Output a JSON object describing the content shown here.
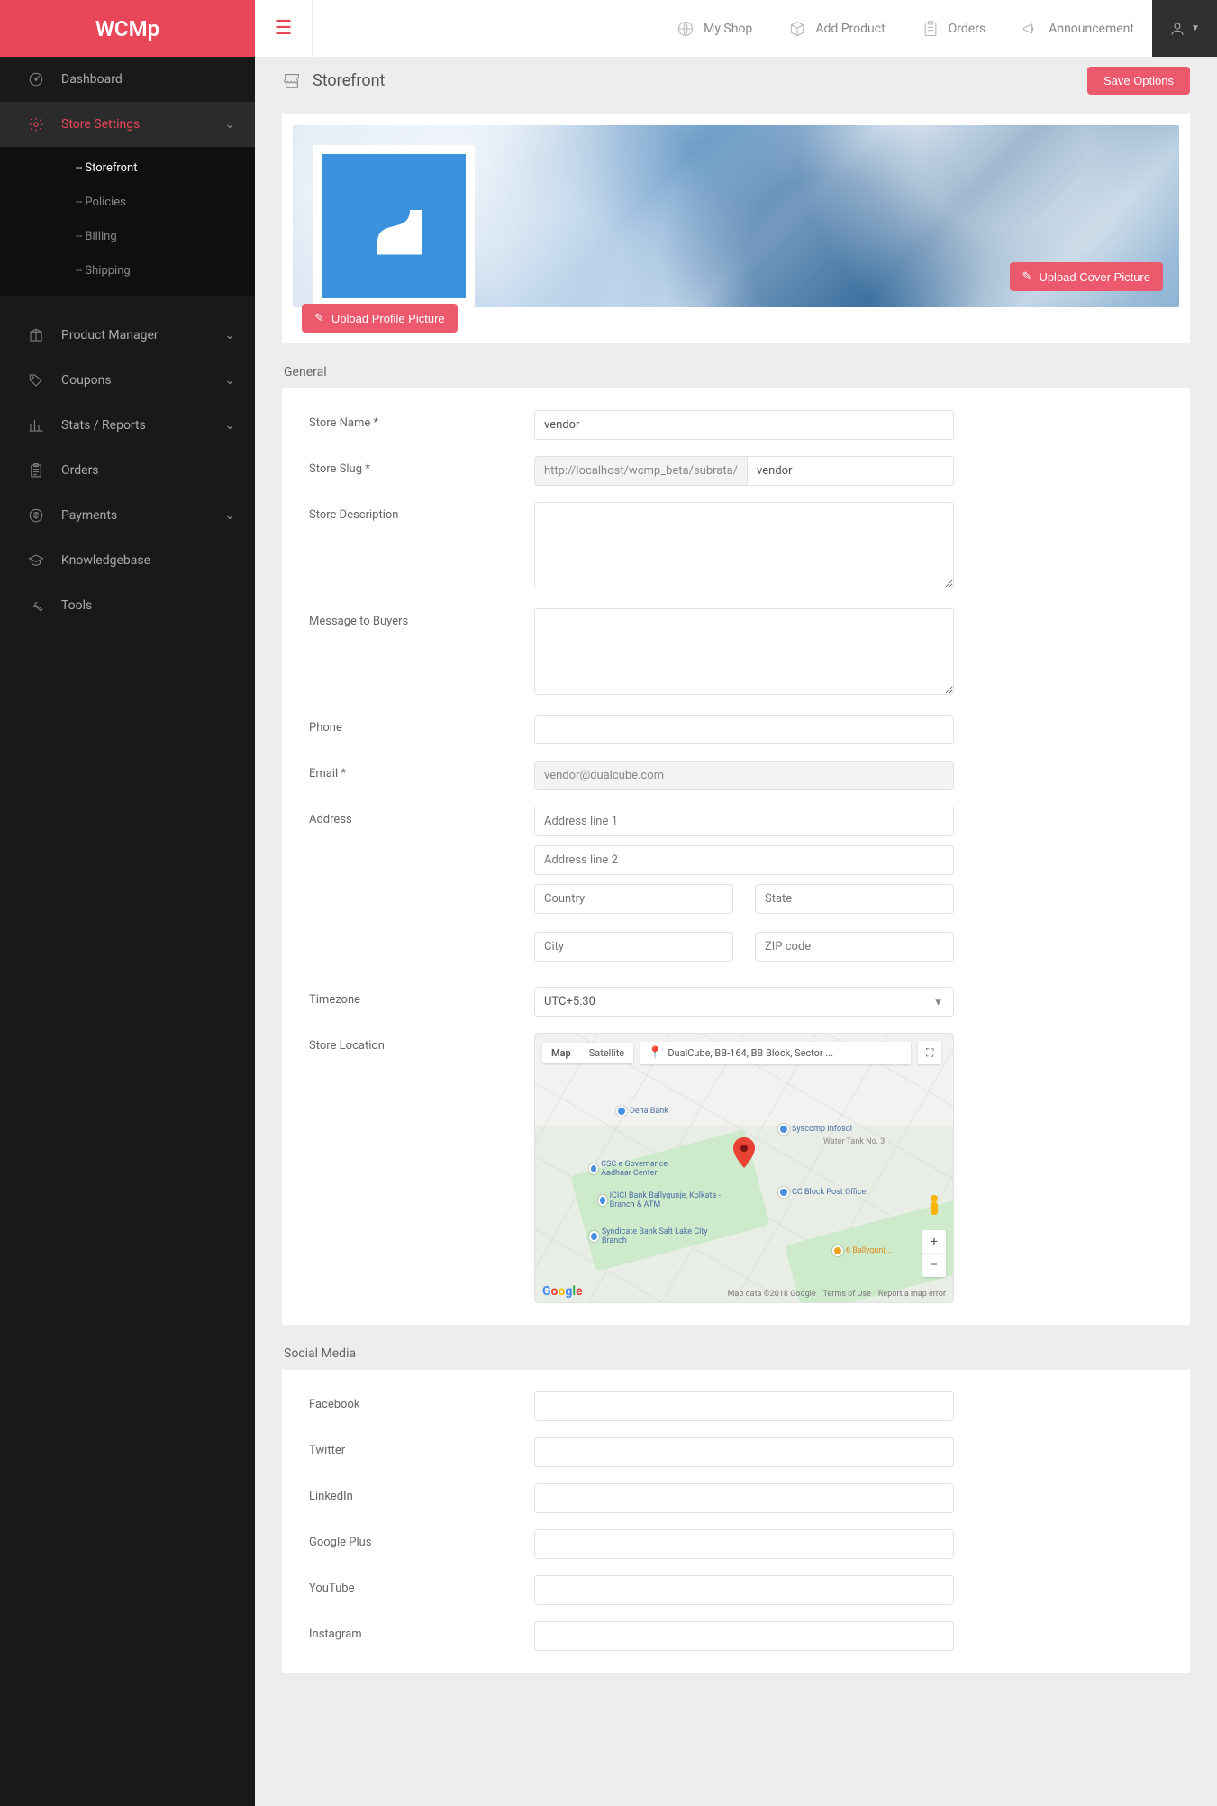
{
  "brand": "WCMp",
  "toplinks": {
    "my_shop": "My Shop",
    "add_product": "Add Product",
    "orders": "Orders",
    "announcement": "Announcement"
  },
  "sidenav": {
    "dashboard": "Dashboard",
    "store_settings": "Store Settings",
    "sub": {
      "storefront": "-- Storefront",
      "policies": "-- Policies",
      "billing": "-- Billing",
      "shipping": "-- Shipping"
    },
    "product_manager": "Product Manager",
    "coupons": "Coupons",
    "stats": "Stats / Reports",
    "orders": "Orders",
    "payments": "Payments",
    "knowledgebase": "Knowledgebase",
    "tools": "Tools"
  },
  "page": {
    "title": "Storefront",
    "save_btn": "Save Options"
  },
  "hero": {
    "upload_cover": "Upload Cover Picture",
    "upload_profile": "Upload Profile Picture"
  },
  "sections": {
    "general": "General",
    "social": "Social Media"
  },
  "form": {
    "store_name_label": "Store Name *",
    "store_name_value": "vendor",
    "store_slug_label": "Store Slug *",
    "store_slug_prefix": "http://localhost/wcmp_beta/subrata/",
    "store_slug_value": "vendor",
    "store_desc_label": "Store Description",
    "message_label": "Message to Buyers",
    "phone_label": "Phone",
    "email_label": "Email *",
    "email_value": "vendor@dualcube.com",
    "address_label": "Address",
    "addr1_ph": "Address line 1",
    "addr2_ph": "Address line 2",
    "country_ph": "Country",
    "state_ph": "State",
    "city_ph": "City",
    "zip_ph": "ZIP code",
    "timezone_label": "Timezone",
    "timezone_value": "UTC+5:30",
    "location_label": "Store Location"
  },
  "map": {
    "tab_map": "Map",
    "tab_sat": "Satellite",
    "search_value": "DualCube, BB-164, BB Block, Sector ...",
    "attrib": "Map data ©2018 Google",
    "terms": "Terms of Use",
    "report": "Report a map error",
    "poi1": "Dena Bank",
    "poi2": "Syscomp Infosol",
    "poi3": "CSC e Governance Aadhaar Center",
    "poi4": "ICICI Bank Ballygunje, Kolkata - Branch & ATM",
    "poi5": "Syndicate Bank Salt Lake City Branch",
    "poi6": "CC Block Post Office",
    "poi7": "Water Tank No. 3",
    "poi8": "6 Ballygunj..."
  },
  "social": {
    "facebook": "Facebook",
    "twitter": "Twitter",
    "linkedin": "LinkedIn",
    "google_plus": "Google Plus",
    "youtube": "YouTube",
    "instagram": "Instagram"
  }
}
